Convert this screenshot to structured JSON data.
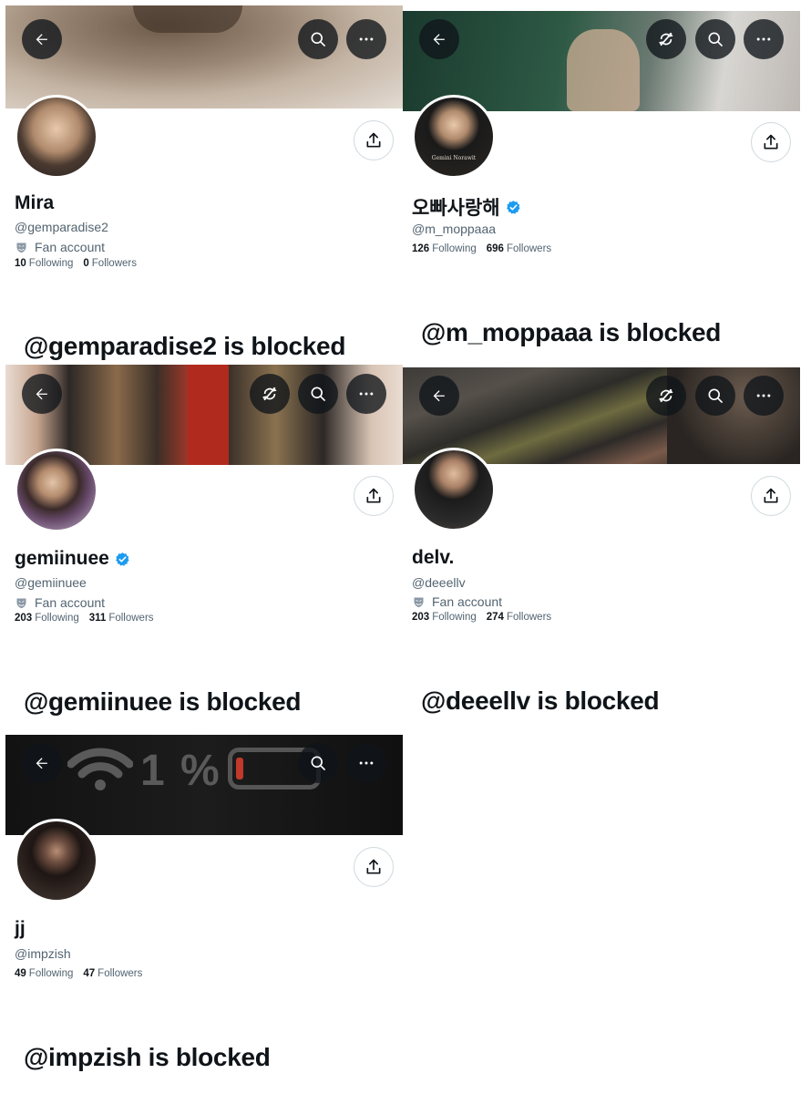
{
  "icons": {
    "back": "arrow-left-icon",
    "search": "search-icon",
    "more": "more-dots-icon",
    "unfollow": "refresh-slash-icon",
    "share": "share-icon",
    "fan": "fan-account-mask-icon",
    "verified": "verified-badge-icon"
  },
  "colors": {
    "verified": "#1d9bf0",
    "text": "#0f1419",
    "muted": "#536471"
  },
  "profiles": [
    {
      "name": "Mira",
      "handle": "@gemparadise2",
      "fan_label": "Fan account",
      "following": "10",
      "following_label": "Following",
      "followers": "0",
      "followers_label": "Followers",
      "blocked_text": "@gemparadise2 is blocked",
      "banner_desc": "cat close-up"
    },
    {
      "name": "오빠사랑해",
      "handle": "@m_moppaaa",
      "avatar_caption": "Gemini Norawit",
      "following": "126",
      "following_label": "Following",
      "followers": "696",
      "followers_label": "Followers",
      "blocked_text": "@m_moppaaa is blocked"
    },
    {
      "name": "gemiinuee",
      "handle": "@gemiinuee",
      "fan_label": "Fan account",
      "following": "203",
      "following_label": "Following",
      "followers": "311",
      "followers_label": "Followers",
      "blocked_text": "@gemiinuee is blocked"
    },
    {
      "name": "delv.",
      "handle": "@deeellv",
      "fan_label": "Fan account",
      "following": "203",
      "following_label": "Following",
      "followers": "274",
      "followers_label": "Followers",
      "blocked_text": "@deeellv is blocked"
    },
    {
      "name": "jj",
      "handle": "@impzish",
      "banner_text": "1 %",
      "following": "49",
      "following_label": "Following",
      "followers": "47",
      "followers_label": "Followers",
      "blocked_text": "@impzish is blocked"
    }
  ]
}
